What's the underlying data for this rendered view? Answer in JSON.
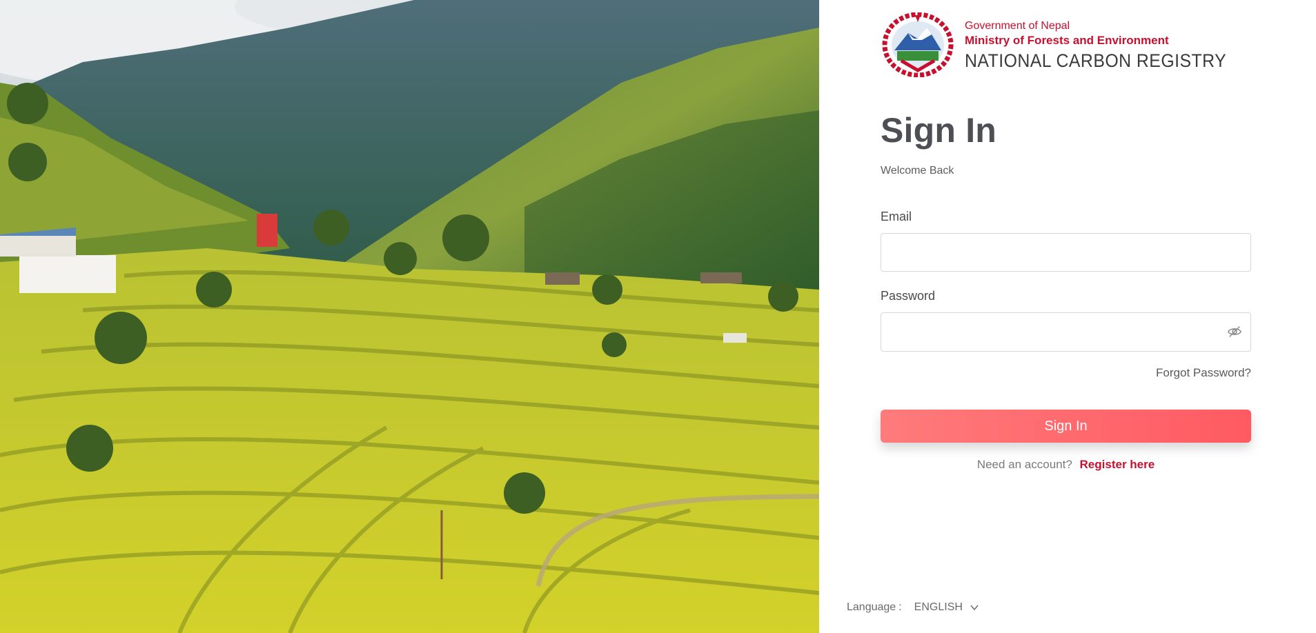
{
  "brand": {
    "emblem_icon": "nepal-emblem-icon",
    "government": "Government of Nepal",
    "ministry": "Ministry of Forests and Environment",
    "registry": "NATIONAL CARBON REGISTRY"
  },
  "hero": {
    "icon": "rice-terrace-landscape-image"
  },
  "signin": {
    "title": "Sign In",
    "subtitle": "Welcome Back",
    "email_label": "Email",
    "email_value": "",
    "password_label": "Password",
    "password_value": "",
    "toggle_icon": "eye-slash-icon",
    "forgot": "Forgot Password?",
    "button": "Sign In",
    "need_account": "Need an account?",
    "register": "Register here"
  },
  "language": {
    "label": "Language",
    "separator": ":",
    "value": "ENGLISH",
    "icon": "chevron-down-icon"
  },
  "colors": {
    "brand_red": "#c8102e",
    "button_start": "#ff7b7b",
    "button_end": "#ff5a62",
    "title_gray": "#4e4e55"
  }
}
